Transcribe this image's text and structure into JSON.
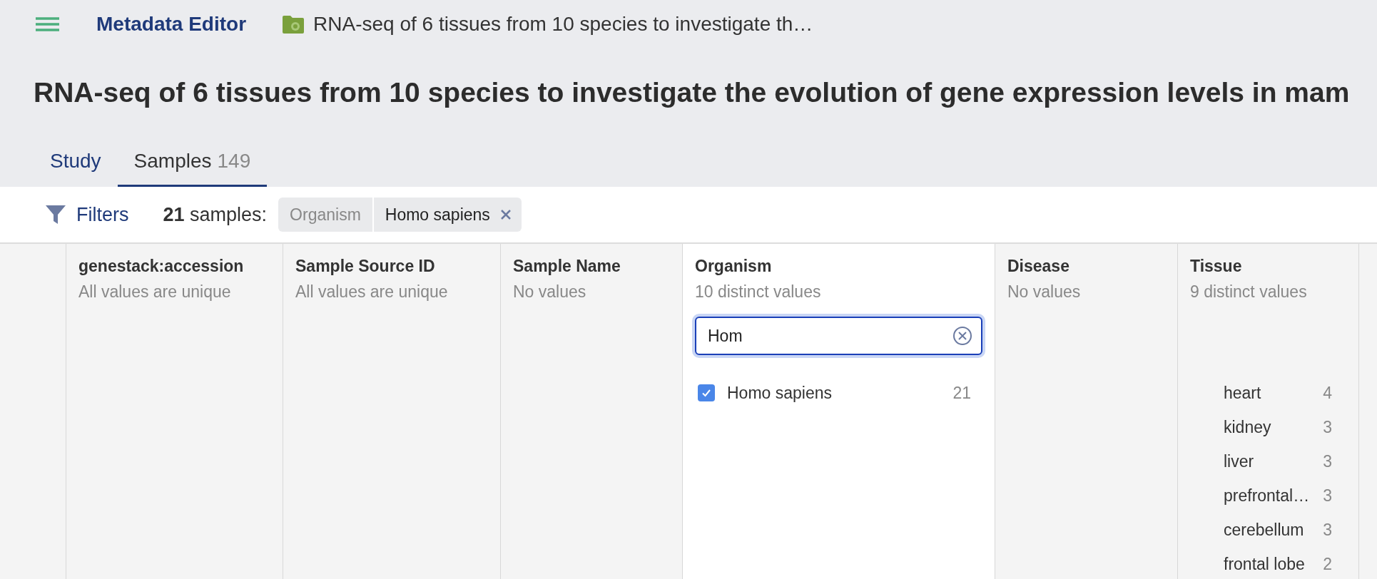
{
  "topbar": {
    "app_title": "Metadata Editor",
    "breadcrumb": "RNA-seq of 6 tissues from 10 species to investigate th…"
  },
  "page_title": "RNA-seq of 6 tissues from 10 species to investigate the evolution of gene expression levels in mam",
  "tabs": [
    {
      "label": "Study",
      "selected": false
    },
    {
      "label": "Samples",
      "count": "149",
      "selected": true
    }
  ],
  "filter_bar": {
    "filters_label": "Filters",
    "count": "21",
    "count_label": "samples:",
    "chips": [
      {
        "field": "Organism",
        "value": "Homo sapiens"
      }
    ]
  },
  "columns": [
    {
      "heading": "genestack:accession",
      "subtitle": "All values are unique"
    },
    {
      "heading": "Sample Source ID",
      "subtitle": "All values are unique"
    },
    {
      "heading": "Sample Name",
      "subtitle": "No values"
    },
    {
      "heading": "Organism",
      "subtitle": "10 distinct values",
      "search": {
        "value": "Hom"
      },
      "values": [
        {
          "label": "Homo sapiens",
          "count": "21",
          "checked": true
        }
      ]
    },
    {
      "heading": "Disease",
      "subtitle": "No values"
    },
    {
      "heading": "Tissue",
      "subtitle": "9 distinct values",
      "values": [
        {
          "label": "heart",
          "count": "4"
        },
        {
          "label": "kidney",
          "count": "3"
        },
        {
          "label": "liver",
          "count": "3"
        },
        {
          "label": "prefrontal…",
          "count": "3"
        },
        {
          "label": "cerebellum",
          "count": "3"
        },
        {
          "label": "frontal lobe",
          "count": "2"
        }
      ]
    }
  ]
}
